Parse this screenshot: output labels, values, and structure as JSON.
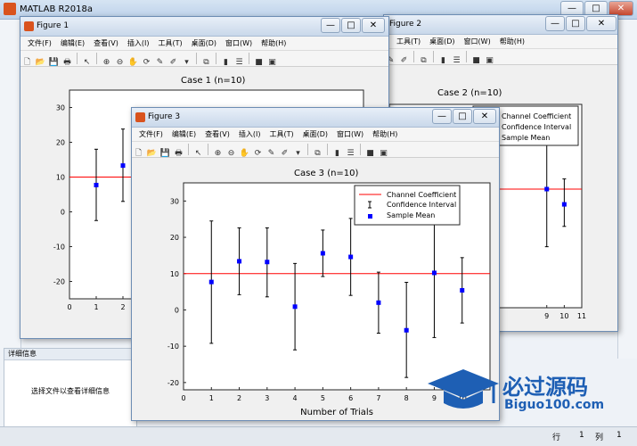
{
  "matlab": {
    "title": "MATLAB R2018a",
    "details_header": "详细信息",
    "details_message": "选择文件以查看详细信息",
    "status_row_label": "行",
    "status_row_value": "1",
    "status_col_label": "列",
    "status_col_value": "1"
  },
  "window_buttons": {
    "minimize": "—",
    "maximize": "□",
    "close": "✕"
  },
  "menu": [
    "文件(F)",
    "编辑(E)",
    "查看(V)",
    "插入(I)",
    "工具(T)",
    "桌面(D)",
    "窗口(W)",
    "帮助(H)"
  ],
  "menu_right": [
    "工具(T)",
    "桌面(D)",
    "窗口(W)",
    "帮助(H)"
  ],
  "toolbar_icons": [
    "new-file-icon",
    "open-folder-icon",
    "save-icon",
    "print-icon",
    "|",
    "pointer-icon",
    "|",
    "zoom-in-icon",
    "zoom-out-icon",
    "pan-hand-icon",
    "rotate-3d-icon",
    "data-cursor-icon",
    "brush-icon",
    "dropdown-icon",
    "|",
    "link-plot-icon",
    "|",
    "colorbar-icon",
    "legend-icon",
    "|",
    "hide-tools-icon",
    "dock-icon"
  ],
  "figures": [
    {
      "window_title": "Figure 1",
      "plot_title": "Case 1 (n=10)"
    },
    {
      "window_title": "Figure 2",
      "plot_title": "Case 2 (n=10)"
    },
    {
      "window_title": "Figure 3",
      "plot_title": "Case 3 (n=10)"
    }
  ],
  "legend": {
    "channel": "Channel Coefficient",
    "ci": "Confidence Interval",
    "mean": "Sample Mean"
  },
  "watermark": {
    "name": "必过源码",
    "url": "Biguo100.com"
  },
  "colors": {
    "reference_line": "#ff0000",
    "mean_marker": "#0000ff",
    "errorbar": "#000000"
  },
  "chart_data": [
    {
      "type": "scatter",
      "title": "Case 3 (n=10)",
      "xlabel": "Number of Trials",
      "ylabel": "",
      "xlim": [
        0,
        11
      ],
      "ylim": [
        -22,
        35
      ],
      "xticks": [
        0,
        1,
        2,
        3,
        4,
        5,
        6,
        7,
        8,
        9,
        10
      ],
      "yticks": [
        -20,
        -10,
        0,
        10,
        20,
        30
      ],
      "reference_line": 10,
      "legend_position": "top-right",
      "series": [
        {
          "name": "Sample Mean",
          "x": [
            1,
            2,
            3,
            4,
            5,
            6,
            7,
            8,
            9,
            10
          ],
          "y": [
            7.7,
            13.4,
            13.2,
            0.9,
            15.6,
            14.6,
            2.0,
            -5.6,
            10.2,
            5.4
          ],
          "lower": [
            -9.2,
            4.2,
            3.6,
            -11.0,
            9.2,
            4.0,
            -6.4,
            -18.6,
            -7.6,
            -3.6
          ],
          "upper": [
            24.5,
            22.6,
            22.6,
            12.8,
            22.0,
            25.2,
            10.4,
            7.6,
            28.0,
            14.4
          ]
        }
      ]
    },
    {
      "type": "scatter",
      "title": "Case 1 (n=10)",
      "xlim": [
        0,
        11
      ],
      "ylim": [
        -25,
        35
      ],
      "xticks": [
        0,
        1,
        2
      ],
      "yticks": [
        -20,
        -10,
        0,
        10,
        20,
        30
      ],
      "reference_line": 10,
      "series": [
        {
          "name": "Sample Mean",
          "x": [
            1,
            2
          ],
          "y": [
            7.7,
            13.3
          ],
          "lower": [
            -2.5,
            3.0
          ],
          "upper": [
            18.0,
            23.8
          ]
        }
      ]
    },
    {
      "type": "scatter",
      "title": "Case 2 (n=10)",
      "xlim": [
        0,
        11
      ],
      "xticks": [
        9,
        10,
        11
      ],
      "reference_line": 10,
      "series": [
        {
          "name": "Sample Mean",
          "x": [
            9,
            10
          ],
          "y": [
            10.0,
            5.5
          ],
          "lower": [
            -7.0,
            -1.0
          ],
          "upper": [
            26.0,
            13.0
          ]
        }
      ]
    }
  ]
}
